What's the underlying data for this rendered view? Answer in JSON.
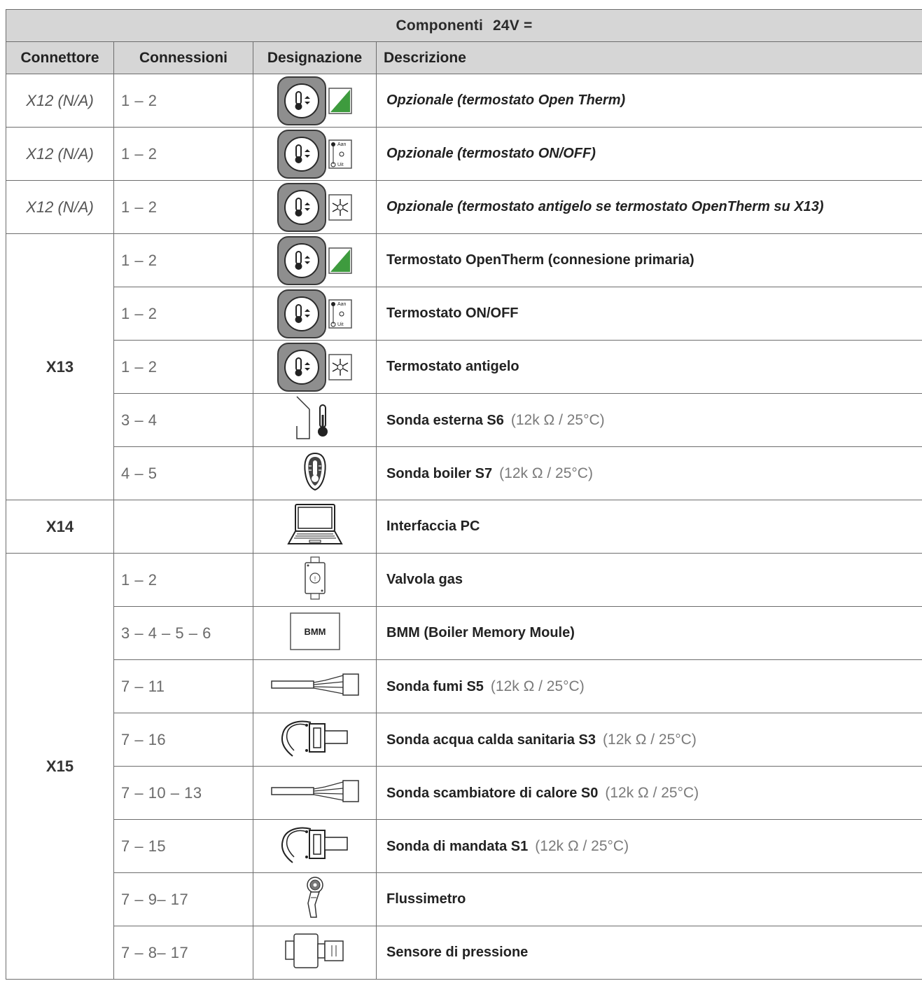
{
  "title": {
    "label": "Componenti",
    "voltage": "24V ="
  },
  "headers": {
    "connector": "Connettore",
    "connections": "Connessioni",
    "designation": "Designazione",
    "description": "Descrizione"
  },
  "connector_groups": {
    "x13": "X13",
    "x14": "X14",
    "x15": "X15"
  },
  "rows": [
    {
      "connector": "X12 (N/A)",
      "pins": "1 – 2",
      "icon": "thermostat-opentherm-icon",
      "desc": "Opzionale (termostato Open Therm)",
      "spec": ""
    },
    {
      "connector": "X12 (N/A)",
      "pins": "1 – 2",
      "icon": "thermostat-onoff-icon",
      "desc": "Opzionale (termostato ON/OFF)",
      "spec": ""
    },
    {
      "connector": "X12 (N/A)",
      "pins": "1 – 2",
      "icon": "thermostat-frost-icon",
      "desc": "Opzionale (termostato antigelo se termostato OpenTherm su X13)",
      "spec": ""
    },
    {
      "connector": "X13",
      "pins": "1 – 2",
      "icon": "thermostat-opentherm-icon",
      "desc": "Termostato OpenTherm (connesione primaria)",
      "spec": ""
    },
    {
      "connector": "X13",
      "pins": "1 – 2",
      "icon": "thermostat-onoff-icon",
      "desc": "Termostato ON/OFF",
      "spec": ""
    },
    {
      "connector": "X13",
      "pins": "1 – 2",
      "icon": "thermostat-frost-icon",
      "desc": "Termostato antigelo",
      "spec": ""
    },
    {
      "connector": "X13",
      "pins": "3 – 4",
      "icon": "outdoor-sensor-icon",
      "desc": "Sonda esterna S6",
      "spec": "(12k Ω / 25°C)"
    },
    {
      "connector": "X13",
      "pins": "4 – 5",
      "icon": "boiler-sensor-icon",
      "desc": "Sonda boiler S7",
      "spec": "(12k Ω / 25°C)"
    },
    {
      "connector": "X14",
      "pins": "",
      "icon": "laptop-icon",
      "desc": "Interfaccia PC",
      "spec": ""
    },
    {
      "connector": "X15",
      "pins": "1 – 2",
      "icon": "gas-valve-icon",
      "desc": "Valvola gas",
      "spec": ""
    },
    {
      "connector": "X15",
      "pins": "3 – 4 – 5 – 6",
      "icon": "bmm-icon",
      "desc": "BMM (Boiler Memory Moule)",
      "spec": ""
    },
    {
      "connector": "X15",
      "pins": "7 – 11",
      "icon": "probe-icon",
      "desc": "Sonda fumi S5",
      "spec": "(12k Ω / 25°C)"
    },
    {
      "connector": "X15",
      "pins": "7 – 16",
      "icon": "clip-sensor-icon",
      "desc": "Sonda acqua calda sanitaria S3",
      "spec": "(12k Ω / 25°C)"
    },
    {
      "connector": "X15",
      "pins": "7 – 10 – 13",
      "icon": "probe-icon",
      "desc": "Sonda scambiatore di calore S0",
      "spec": "(12k Ω / 25°C)"
    },
    {
      "connector": "X15",
      "pins": "7 – 15",
      "icon": "clip-sensor-icon",
      "desc": "Sonda di mandata S1",
      "spec": "(12k Ω / 25°C)"
    },
    {
      "connector": "X15",
      "pins": "7 – 9– 17",
      "icon": "flowmeter-icon",
      "desc": "Flussimetro",
      "spec": ""
    },
    {
      "connector": "X15",
      "pins": "7 – 8– 17",
      "icon": "pressure-sensor-icon",
      "desc": "Sensore di pressione",
      "spec": ""
    }
  ],
  "icon_text": {
    "aan": "Aan",
    "uit": "Uit",
    "bmm": "BMM"
  }
}
